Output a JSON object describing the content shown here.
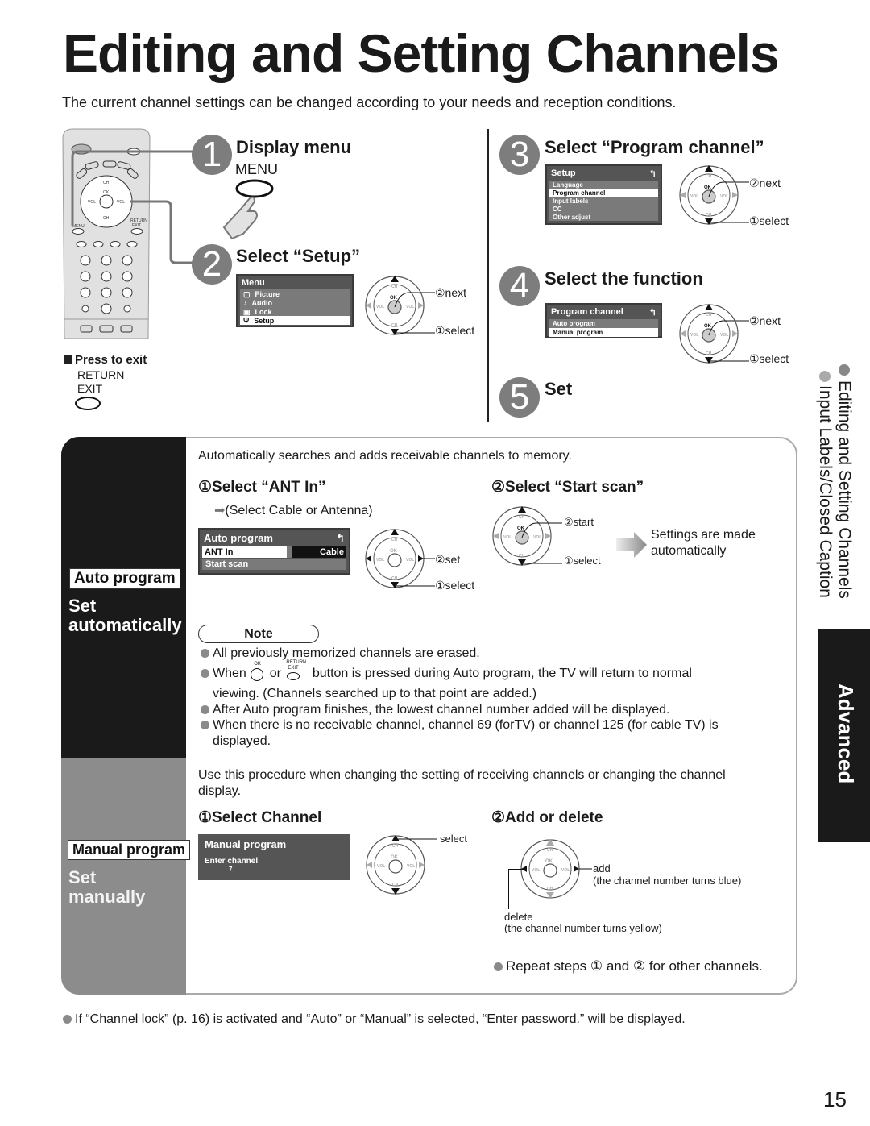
{
  "page": {
    "title": "Editing and Setting Channels",
    "subtitle": "The current channel settings can be changed according to your needs and reception conditions.",
    "page_number": "15"
  },
  "remote": {
    "labels": {
      "ch": "CH",
      "ok": "OK",
      "vol": "VOL",
      "menu": "MENU",
      "return_exit": "RETURN EXIT"
    }
  },
  "exit_note": {
    "heading": "Press to exit",
    "line1": "RETURN",
    "line2": "EXIT"
  },
  "steps": [
    {
      "num": "1",
      "title": "Display menu",
      "button_label": "MENU"
    },
    {
      "num": "2",
      "title": "Select “Setup”",
      "menu": {
        "title": "Menu",
        "items": [
          {
            "icon": "picture-icon",
            "glyph": "▢",
            "label": "Picture"
          },
          {
            "icon": "audio-icon",
            "glyph": "♪",
            "label": "Audio"
          },
          {
            "icon": "lock-icon",
            "glyph": "🔒",
            "label": "Lock"
          },
          {
            "icon": "setup-icon",
            "glyph": "Ψ",
            "label": "Setup",
            "selected": true
          }
        ]
      },
      "next": "②next",
      "select": "①select"
    },
    {
      "num": "3",
      "title": "Select “Program channel”",
      "menu": {
        "title": "Setup",
        "items": [
          {
            "label": "Language"
          },
          {
            "label": "Program channel",
            "selected": true
          },
          {
            "label": "Input labels"
          },
          {
            "label": "CC"
          },
          {
            "label": "Other adjust"
          }
        ]
      },
      "next": "②next",
      "select": "①select"
    },
    {
      "num": "4",
      "title": "Select the function",
      "menu": {
        "title": "Program channel",
        "items": [
          {
            "label": "Auto program"
          },
          {
            "label": "Manual program",
            "selected": true
          }
        ]
      },
      "next": "②next",
      "select": "①select"
    },
    {
      "num": "5",
      "title": "Set"
    }
  ],
  "auto": {
    "tag": "Auto program",
    "side_text_1": "Set",
    "side_text_2": "automatically",
    "intro": "Automatically searches and adds receivable channels to memory.",
    "step1_title": "①Select “ANT In”",
    "step1_hint": "(Select Cable or Antenna)",
    "menu": {
      "title": "Auto program",
      "row1_label": "ANT In",
      "row1_value": "Cable",
      "row2_label": "Start scan"
    },
    "step1_set": "②set",
    "step1_select": "①select",
    "step2_title": "②Select “Start scan”",
    "step2_start": "②start",
    "step2_select": "①select",
    "result_line1": "Settings are made",
    "result_line2": "automatically",
    "note_title": "Note",
    "notes": [
      "All previously memorized channels are erased.",
      "button is pressed during Auto program, the TV will return to normal",
      "viewing. (Channels searched up to that point are added.)",
      "After Auto program finishes, the lowest channel number added will be displayed.",
      "When there is no receivable channel, channel 69 (forTV) or channel 125 (for cable TV) is",
      "displayed."
    ],
    "note2_prefix": "When",
    "note2_or": "or",
    "ok_label": "OK",
    "return_label": "RETURN",
    "exit_label": "EXIT"
  },
  "manual": {
    "tag": "Manual program",
    "side_text_1": "Set",
    "side_text_2": "manually",
    "intro_line1": "Use this procedure when changing the setting of receiving channels or changing the channel",
    "intro_line2": "display.",
    "step1_title": "①Select Channel",
    "menu": {
      "title": "Manual program",
      "label": "Enter channel",
      "value": "7"
    },
    "select": "select",
    "step2_title": "②Add or delete",
    "add": "add",
    "add_note": "(the channel number turns blue)",
    "delete": "delete",
    "delete_note": "(the channel number turns yellow)",
    "repeat": "Repeat steps ① and ② for other channels."
  },
  "footer_note": "If “Channel lock” (p. 16) is activated and “Auto” or “Manual” is selected, “Enter password.” will be displayed.",
  "side_index": {
    "item1": "Editing and Setting Channels",
    "item2": "Input Labels/Closed Caption",
    "tab": "Advanced"
  }
}
